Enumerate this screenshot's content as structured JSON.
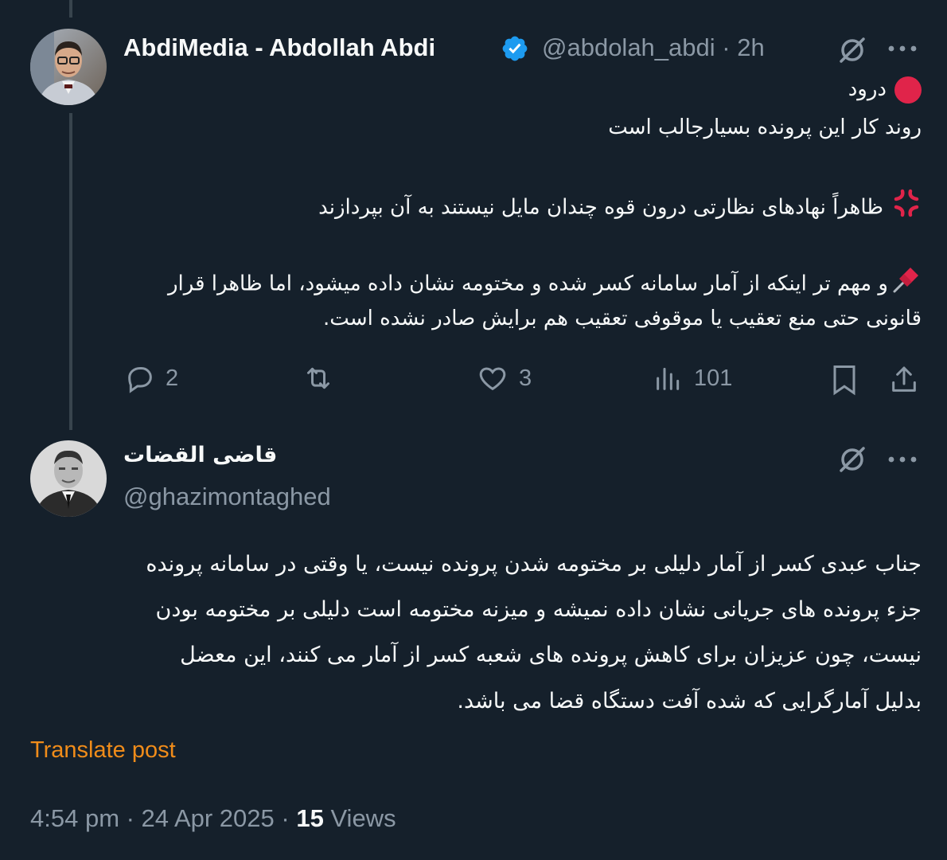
{
  "post1": {
    "display_name": "AbdiMedia - Abdollah Abdi",
    "handle": "@abdolah_abdi",
    "separator": "·",
    "time": "2h",
    "lines": [
      "درود",
      "روند کار این پرونده بسیارجالب است",
      "ظاهراً نهادهای نظارتی درون قوه چندان مایل نیستند به آن بپردازند",
      "و مهم تر اینکه از آمار سامانه کسر شده و مختومه نشان داده میشود، اما ظاهرا قرار",
      "قانونی حتی منع تعقیب یا موقوفی تعقیب هم برایش صادر نشده است."
    ],
    "actions": {
      "replies": "2",
      "likes": "3",
      "views": "101"
    }
  },
  "post2": {
    "display_name": "قاضی القضات",
    "handle": "@ghazimontaghed",
    "lines": [
      "جناب عبدی کسر از آمار دلیلی بر مختومه شدن پرونده نیست، یا وقتی در سامانه پرونده",
      "جزء پرونده های جریانی نشان داده نمیشه و میزنه مختومه است دلیلی بر مختومه بودن",
      "نیست، چون عزیزان برای کاهش پرونده های شعبه کسر از آمار می کنند، این معضل",
      "بدلیل آمارگرایی که شده آفت دستگاه قضا می باشد."
    ],
    "translate_label": "Translate post",
    "timestamp": "4:54 pm · 24 Apr 2025 ·",
    "views_count": "15",
    "views_label": "Views"
  },
  "icons": {
    "verified": "verified-badge-icon",
    "grok": "grok-icon",
    "more": "more-icon",
    "reply": "reply-icon",
    "repost": "repost-icon",
    "like": "like-icon",
    "views": "views-icon",
    "bookmark": "bookmark-icon",
    "share": "share-icon",
    "red_circle": "red-circle-emoji",
    "anger": "anger-emoji",
    "pushpin": "pushpin-emoji"
  },
  "colors": {
    "background": "#15202b",
    "text": "#f7f9f9",
    "muted": "#8b98a5",
    "verified": "#1d9bf0",
    "translate": "#f08c1a",
    "emoji_red": "#e0244a"
  }
}
